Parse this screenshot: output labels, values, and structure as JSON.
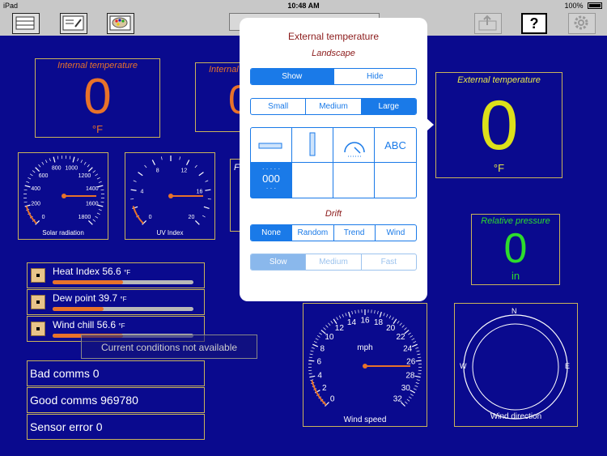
{
  "status": {
    "device": "iPad",
    "time": "10:48 AM",
    "battery": "100%"
  },
  "toolbar": {
    "help_label": "?"
  },
  "internal_temp": {
    "title": "Internal temperature",
    "value": "0",
    "unit": "°F"
  },
  "internal_temp2": {
    "title": "Internal"
  },
  "external_temp": {
    "title": "External temperature",
    "value": "0",
    "unit": "°F"
  },
  "pressure": {
    "title": "Relative pressure",
    "value": "0",
    "unit": "in"
  },
  "solar": {
    "label": "Solar radiation",
    "ticks": [
      "0",
      "200",
      "400",
      "600",
      "800",
      "1000",
      "1200",
      "1400",
      "1600",
      "1800"
    ]
  },
  "uv": {
    "label": "UV Index",
    "ticks": [
      "0",
      "4",
      "8",
      "12",
      "16",
      "20"
    ],
    "ticks_all": [
      "0",
      "2",
      "4",
      "6",
      "8",
      "10",
      "12",
      "14",
      "16",
      "18",
      "20"
    ]
  },
  "wind_speed": {
    "label": "Wind speed",
    "unit": "mph",
    "ticks": [
      "0",
      "2",
      "4",
      "6",
      "8",
      "10",
      "12",
      "14",
      "16",
      "18",
      "20",
      "22",
      "24",
      "26",
      "28",
      "30",
      "32"
    ]
  },
  "wind_dir": {
    "label": "Wind direction",
    "n": "N",
    "s": "S",
    "e": "E",
    "w": "W"
  },
  "bars": [
    {
      "label": "Heat Index 56.6",
      "unit": "°F",
      "fill": 0.5
    },
    {
      "label": "Dew point 39.7",
      "unit": "°F",
      "fill": 0.36
    },
    {
      "label": "Wind chill 56.6",
      "unit": "°F",
      "fill": 0.5
    }
  ],
  "toast": "Current conditions not available",
  "stats": {
    "bad": "Bad comms 0",
    "good": "Good comms 969780",
    "sensor": "Sensor error 0"
  },
  "popover": {
    "title": "External temperature",
    "orientation": "Landscape",
    "visibility": {
      "show": "Show",
      "hide": "Hide"
    },
    "size": {
      "small": "Small",
      "medium": "Medium",
      "large": "Large"
    },
    "style_text": "ABC",
    "style_digits": "000",
    "drift_title": "Drift",
    "drift": {
      "none": "None",
      "random": "Random",
      "trend": "Trend",
      "wind": "Wind"
    },
    "speed": {
      "slow": "Slow",
      "medium": "Medium",
      "fast": "Fast"
    }
  }
}
